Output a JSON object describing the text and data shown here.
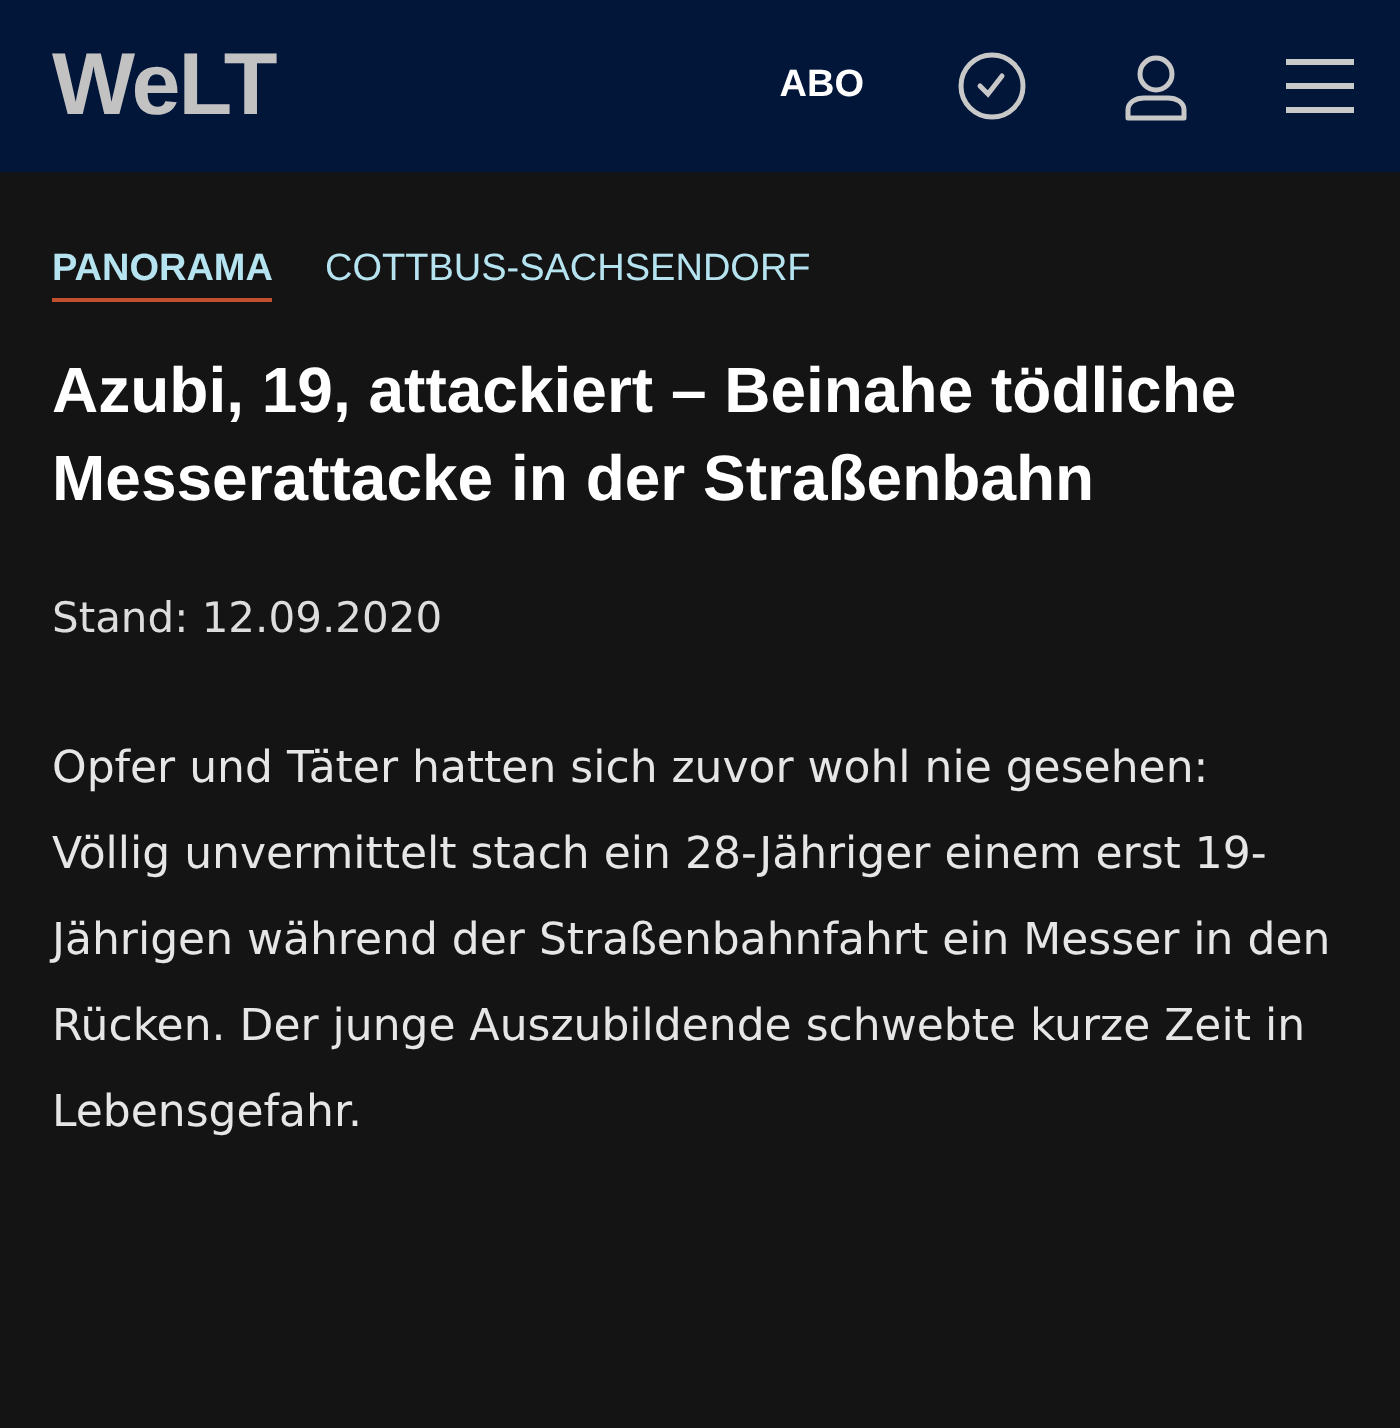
{
  "header": {
    "logo": "WeLT",
    "abo": "ABO"
  },
  "breadcrumbs": [
    {
      "label": "PANORAMA",
      "selected": true
    },
    {
      "label": "COTTBUS-SACHSENDORF",
      "selected": false
    }
  ],
  "headline": "Azubi, 19, attackiert – Beinahe tödliche Messerattacke in der Straßenbahn",
  "date": "Stand: 12.09.2020",
  "teaser": "Opfer und Täter hatten sich zuvor wohl nie gesehen: Völlig unvermittelt stach ein 28-Jähriger einem erst 19-Jährigen während der Straßenbahnfahrt ein Messer in den Rücken. Der junge Auszubildende schwebte kurze Zeit in Lebensgefahr."
}
